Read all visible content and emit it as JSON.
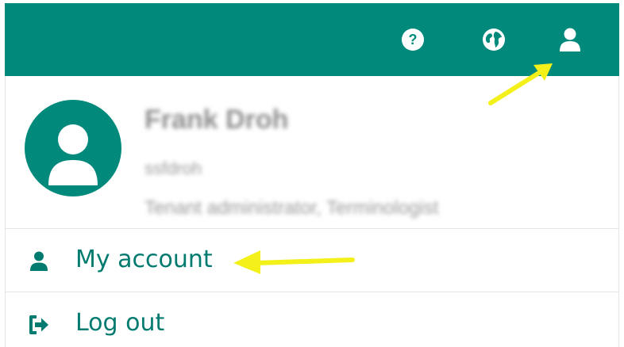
{
  "topbar": {
    "background": "#018a7c",
    "icons": [
      "help-icon",
      "globe-icon",
      "user-icon"
    ],
    "help_glyph": "?"
  },
  "profile": {
    "name": "Frank Droh",
    "login": "ssfdroh",
    "roles": "Tenant administrator, Terminologist",
    "avatar_color": "#018a7c"
  },
  "menu": {
    "my_account_label": "My account",
    "my_account_icon": "user-icon",
    "logout_label": "Log out",
    "logout_icon": "sign-out-icon"
  },
  "annotations": {
    "arrow_color": "#f3f01a"
  }
}
